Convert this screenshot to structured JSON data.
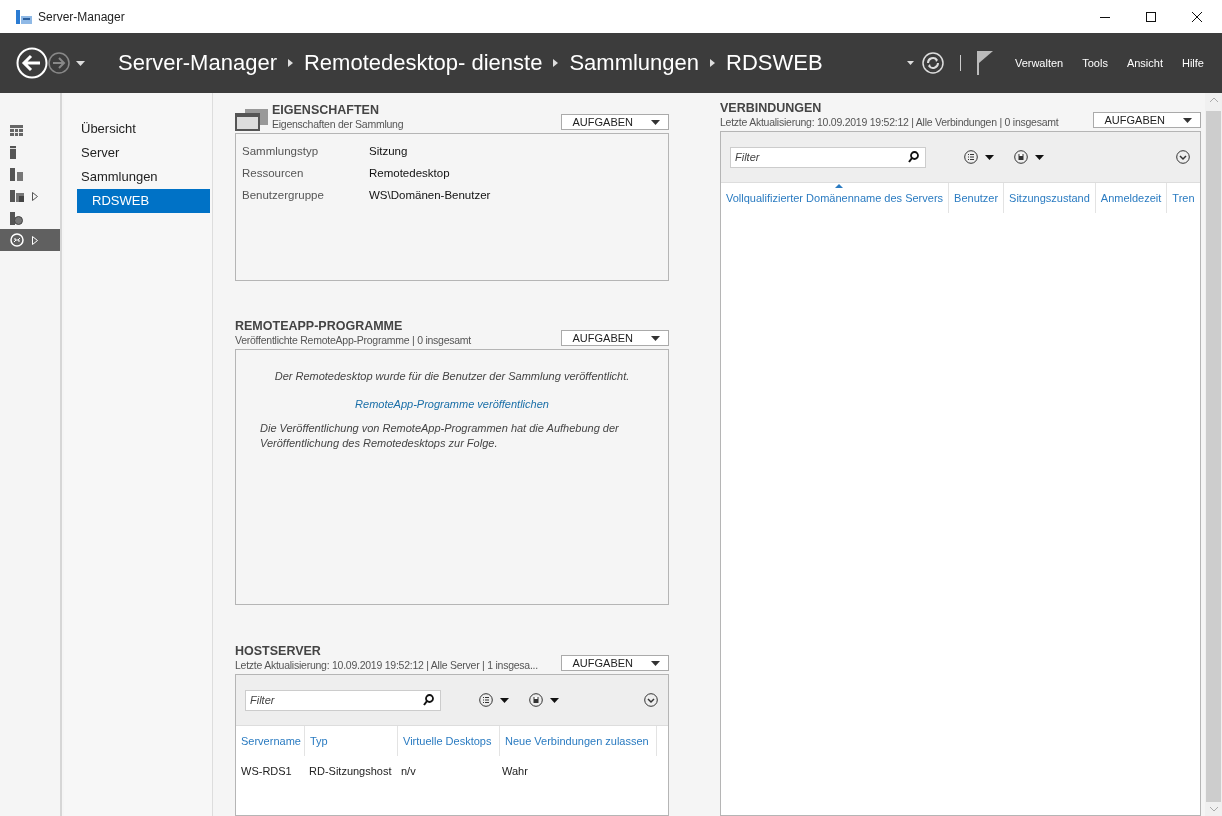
{
  "window": {
    "title": "Server-Manager"
  },
  "header": {
    "breadcrumb": [
      "Server-Manager",
      "Remotedesktop- dienste",
      "Sammlungen",
      "RDSWEB"
    ],
    "menus": [
      "Verwalten",
      "Tools",
      "Ansicht",
      "Hilfe"
    ]
  },
  "rail": [
    {
      "kind": "dashboard",
      "expandable": false,
      "selected": false
    },
    {
      "kind": "server",
      "expandable": false,
      "selected": false
    },
    {
      "kind": "servers",
      "expandable": false,
      "selected": false
    },
    {
      "kind": "files",
      "expandable": true,
      "selected": false
    },
    {
      "kind": "web",
      "expandable": false,
      "selected": false
    },
    {
      "kind": "remote",
      "expandable": true,
      "selected": true
    }
  ],
  "nav": [
    {
      "label": "Übersicht",
      "selected": false,
      "indent": false
    },
    {
      "label": "Server",
      "selected": false,
      "indent": false
    },
    {
      "label": "Sammlungen",
      "selected": false,
      "indent": false
    },
    {
      "label": "RDSWEB",
      "selected": true,
      "indent": true
    }
  ],
  "properties": {
    "title": "EIGENSCHAFTEN",
    "subtitle": "Eigenschaften der Sammlung",
    "tasks": "AUFGABEN",
    "rows": [
      {
        "label": "Sammlungstyp",
        "value": "Sitzung"
      },
      {
        "label": "Ressourcen",
        "value": "Remotedesktop"
      },
      {
        "label": "Benutzergruppe",
        "value": "WS\\Domänen-Benutzer"
      }
    ]
  },
  "remoteapp": {
    "title": "REMOTEAPP-PROGRAMME",
    "subtitle": "Veröffentlichte RemoteApp-Programme | 0 insgesamt",
    "tasks": "AUFGABEN",
    "message": "Der Remotedesktop wurde für die Benutzer der Sammlung veröffentlicht.",
    "link": "RemoteApp-Programme veröffentlichen",
    "note": "Die Veröffentlichung von RemoteApp-Programmen hat die Aufhebung der Veröffentlichung des Remotedesktops zur Folge."
  },
  "hostserver": {
    "title": "HOSTSERVER",
    "subtitle": "Letzte Aktualisierung: 10.09.2019 19:52:12 | Alle Server  | 1 insgesa...",
    "tasks": "AUFGABEN",
    "filter": {
      "placeholder": "Filter"
    },
    "columns": [
      {
        "label": "Servername",
        "sorted": false
      },
      {
        "label": "Typ",
        "sorted": false
      },
      {
        "label": "Virtuelle Desktops",
        "sorted": false
      },
      {
        "label": "Neue Verbindungen zulassen",
        "sorted": false
      }
    ],
    "rows": [
      [
        "WS-RDS1",
        "RD-Sitzungshost",
        "n/v",
        "Wahr"
      ]
    ]
  },
  "connections": {
    "title": "VERBINDUNGEN",
    "subtitle": "Letzte Aktualisierung: 10.09.2019 19:52:12 | Alle Verbindungen  | 0 insgesamt",
    "tasks": "AUFGABEN",
    "filter": {
      "placeholder": "Filter"
    },
    "columns": [
      {
        "label": "Vollqualifizierter Domänenname des Servers",
        "sorted": true
      },
      {
        "label": "Benutzer",
        "sorted": false
      },
      {
        "label": "Sitzungszustand",
        "sorted": false
      },
      {
        "label": "Anmeldezeit",
        "sorted": false
      },
      {
        "label": "Tren",
        "sorted": false
      }
    ]
  }
}
